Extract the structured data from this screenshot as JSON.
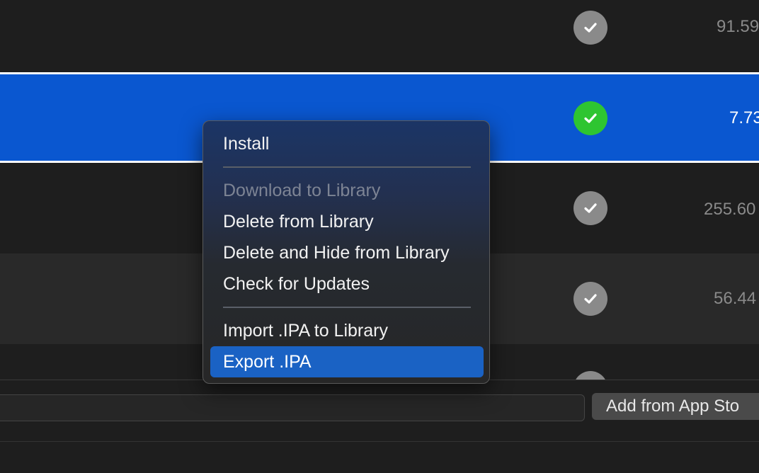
{
  "rows": [
    {
      "size": "91.59",
      "status_icon": "checkmark-circle-icon",
      "status_color": "#8a8a8a"
    },
    {
      "size": "7.73",
      "status_icon": "checkmark-circle-icon",
      "status_color": "#2ec531",
      "selected": true
    },
    {
      "size": "255.60",
      "status_icon": "checkmark-circle-icon",
      "status_color": "#8a8a8a"
    },
    {
      "size": "56.44",
      "status_icon": "checkmark-circle-icon",
      "status_color": "#8a8a8a"
    },
    {
      "size": "",
      "status_icon": "checkmark-circle-icon",
      "status_color": "#8a8a8a"
    }
  ],
  "context_menu": {
    "items": [
      {
        "label": "Install",
        "enabled": true
      },
      {
        "label": "Download to Library",
        "enabled": false
      },
      {
        "label": "Delete from Library",
        "enabled": true
      },
      {
        "label": "Delete and Hide from Library",
        "enabled": true
      },
      {
        "label": "Check for Updates",
        "enabled": true
      },
      {
        "label": "Import .IPA to Library",
        "enabled": true
      },
      {
        "label": "Export .IPA",
        "enabled": true,
        "highlighted": true
      }
    ]
  },
  "bottom_bar": {
    "search_value": "",
    "add_button_label": "Add from App Sto"
  },
  "colors": {
    "selection": "#0a57d0",
    "menu_highlight": "#1a62c4",
    "installed_green": "#2ec531"
  }
}
